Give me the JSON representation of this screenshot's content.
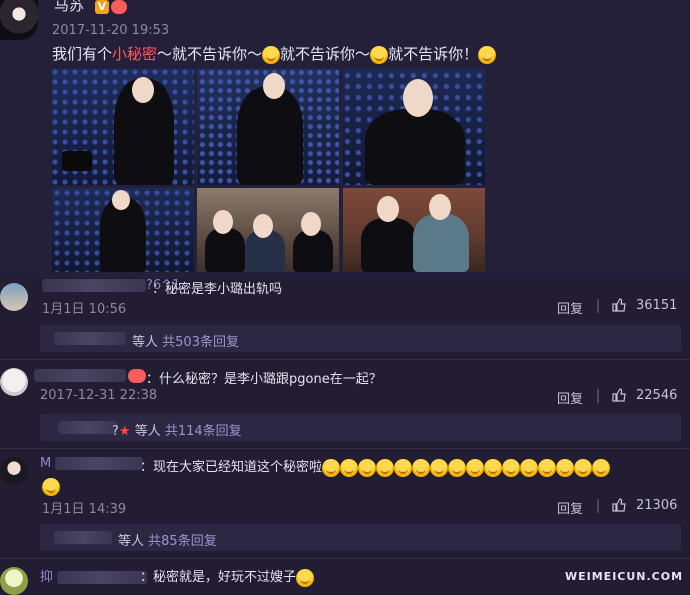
{
  "post": {
    "author": "马苏",
    "verified_badge": "V",
    "timestamp": "2017-11-20 19:53",
    "content_parts": [
      "我们有个",
      "小秘密",
      "～就不告诉你～",
      "就不告诉你～",
      "就不告诉你！"
    ]
  },
  "comments": [
    {
      "name_suffix": "?6^1",
      "text": "：秘密是李小璐出轨吗",
      "time": "1月1日 10:56",
      "reply_label": "回复",
      "likes": "36151",
      "replies_summary": {
        "prefix": "等人",
        "count": "共503条回复"
      }
    },
    {
      "text": "：什么秘密？是李小璐跟pgone在一起？",
      "time": "2017-12-31 22:38",
      "reply_label": "回复",
      "likes": "22546",
      "replies_summary": {
        "prefix": "等人",
        "count": "共114条回复"
      }
    },
    {
      "name_prefix": "M",
      "text": "：现在大家已经知道这个秘密啦",
      "time": "1月1日 14:39",
      "reply_label": "回复",
      "likes": "21306",
      "replies_summary": {
        "prefix": "等人",
        "count": "共85条回复"
      }
    },
    {
      "name_prefix": "抑",
      "text": "：秘密就是，好玩不过嫂子"
    }
  ],
  "watermark": "WEIMEICUN.COM",
  "colors": {
    "background": "#221d33",
    "highlight": "#ff5a5a",
    "link": "#8f89c6"
  }
}
